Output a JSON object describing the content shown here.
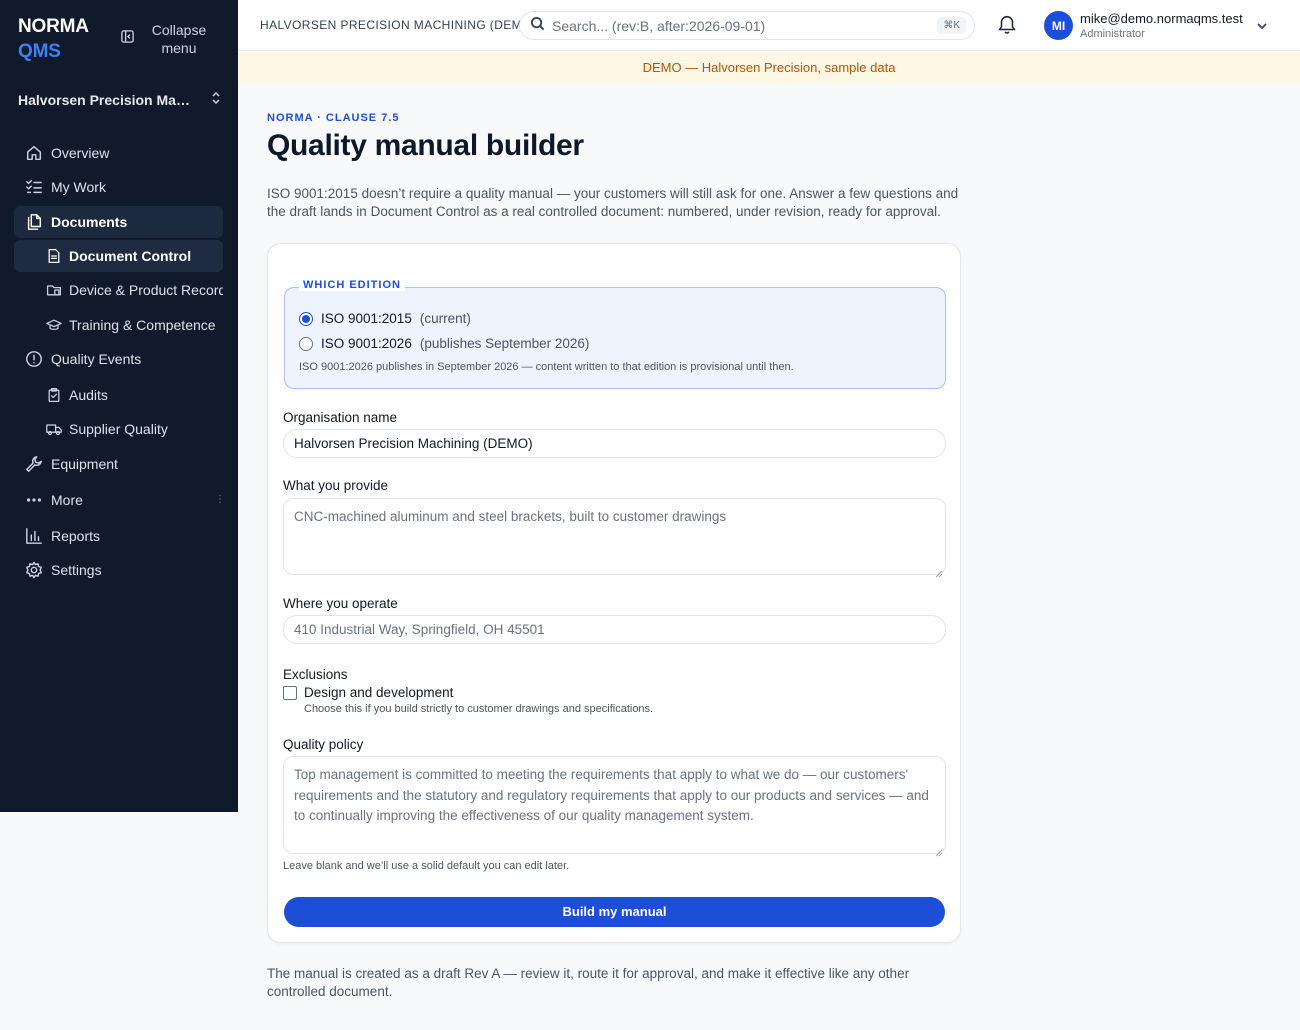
{
  "brand": {
    "line1": "NORMA",
    "line2": "QMS"
  },
  "sidebar": {
    "collapse_label": "Collapse menu",
    "org_name": "Halvorsen Precision Machining (DEMO)",
    "items": [
      {
        "label": "Overview",
        "icon": "home-icon"
      },
      {
        "label": "My Work",
        "icon": "checklist-icon"
      },
      {
        "label": "Documents",
        "icon": "documents-icon"
      },
      {
        "label": "Document Control",
        "icon": "document-icon"
      },
      {
        "label": "Device & Product Records",
        "icon": "folder-device-icon"
      },
      {
        "label": "Training & Competence",
        "icon": "graduation-cap-icon"
      },
      {
        "label": "Quality Events",
        "icon": "alert-circle-icon"
      },
      {
        "label": "Audits",
        "icon": "clipboard-check-icon"
      },
      {
        "label": "Supplier Quality",
        "icon": "truck-icon"
      },
      {
        "label": "Equipment",
        "icon": "wrench-icon"
      },
      {
        "label": "More",
        "icon": "more-dots-icon"
      },
      {
        "label": "Reports",
        "icon": "bar-chart-icon"
      },
      {
        "label": "Settings",
        "icon": "gear-icon"
      }
    ]
  },
  "topbar": {
    "company": "HALVORSEN PRECISION MACHINING (DEMO)",
    "search_placeholder": "Search... (rev:B, after:2026-09-01)",
    "search_shortcut": "⌘K",
    "avatar_initials": "MI",
    "user_email": "mike@demo.normaqms.test",
    "user_role": "Administrator"
  },
  "demo_banner": "DEMO — Halvorsen Precision, sample data",
  "main": {
    "eyebrow": "NORMA · CLAUSE 7.5",
    "title": "Quality manual builder",
    "intro": "ISO 9001:2015 doesn’t require a quality manual — your customers will still ask for one. Answer a few questions and the draft lands in Document Control as a real controlled document: numbered, under revision, ready for approval.",
    "edition": {
      "legend": "WHICH EDITION",
      "options": [
        {
          "label": "ISO 9001:2015",
          "hint": "(current)",
          "selected": true
        },
        {
          "label": "ISO 9001:2026",
          "hint": "(publishes September 2026)",
          "selected": false
        }
      ],
      "note": "ISO 9001:2026 publishes in September 2026 — content written to that edition is provisional until then."
    },
    "org_name_label": "Organisation name",
    "org_name_value": "Halvorsen Precision Machining (DEMO)",
    "provide_label": "What you provide",
    "provide_placeholder": "CNC-machined aluminum and steel brackets, built to customer drawings",
    "operate_label": "Where you operate",
    "operate_placeholder": "410 Industrial Way, Springfield, OH 45501",
    "exclusions_label": "Exclusions",
    "exclusion_option": "Design and development",
    "exclusion_help": "Choose this if you build strictly to customer drawings and specifications.",
    "policy_label": "Quality policy",
    "policy_placeholder": "Top management is committed to meeting the requirements that apply to what we do — our customers' requirements and the statutory and regulatory requirements that apply to our products and services — and to continually improving the effectiveness of our quality management system.",
    "policy_help": "Leave blank and we’ll use a solid default you can edit later.",
    "build_button": "Build my manual",
    "footer_note": "The manual is created as a draft Rev A — review it, route it for approval, and make it effective like any other controlled document."
  },
  "colors": {
    "sidebar_bg": "#101a2b",
    "accent": "#1d4ed8",
    "banner_bg": "#fdf7e3",
    "banner_text": "#b45309"
  }
}
